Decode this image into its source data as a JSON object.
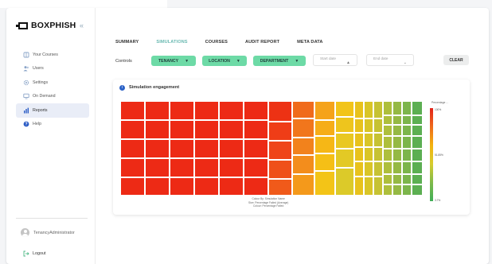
{
  "app": {
    "name": "BOXPHISH"
  },
  "sidebar": {
    "items": [
      {
        "label": "Your Courses",
        "icon": "book-icon"
      },
      {
        "label": "Users",
        "icon": "users-icon"
      },
      {
        "label": "Settings",
        "icon": "gear-icon"
      },
      {
        "label": "On Demand",
        "icon": "monitor-icon"
      },
      {
        "label": "Reports",
        "icon": "bar-chart-icon",
        "active": true
      },
      {
        "label": "Help",
        "icon": "help-icon"
      }
    ],
    "user": "TenancyAdministrator",
    "logout": "Logout"
  },
  "tabs": [
    "SUMMARY",
    "SIMULATIONS",
    "COURSES",
    "AUDIT REPORT",
    "META DATA"
  ],
  "active_tab": "SIMULATIONS",
  "controls": {
    "label": "Controls",
    "filters": [
      "TENANCY",
      "LOCATION",
      "DEPARTMENT"
    ],
    "start_date_placeholder": "Start date",
    "end_date_placeholder": "End date",
    "clear_label": "CLEAR"
  },
  "card": {
    "title": "Simulation engagement",
    "legend_title": "Percentage ...",
    "legend_max": "100%",
    "legend_mid": "51.85%",
    "legend_min": "3.7%",
    "notes": [
      "Colour By: Simulation Name",
      "Size: Percentage Failed (Average)",
      "Colour: Percentage Failed"
    ]
  },
  "colors": {
    "accent": "#6ddaa6",
    "active_tab": "#6ab9b1",
    "heat_high": "#ed2a15",
    "heat_low": "#3fae57"
  },
  "chart_data": {
    "type": "heatmap",
    "title": "Simulation engagement",
    "color_scale": {
      "min": 3.7,
      "mid": 51.85,
      "max": 100,
      "unit": "%"
    },
    "legend_placement": "right"
  }
}
